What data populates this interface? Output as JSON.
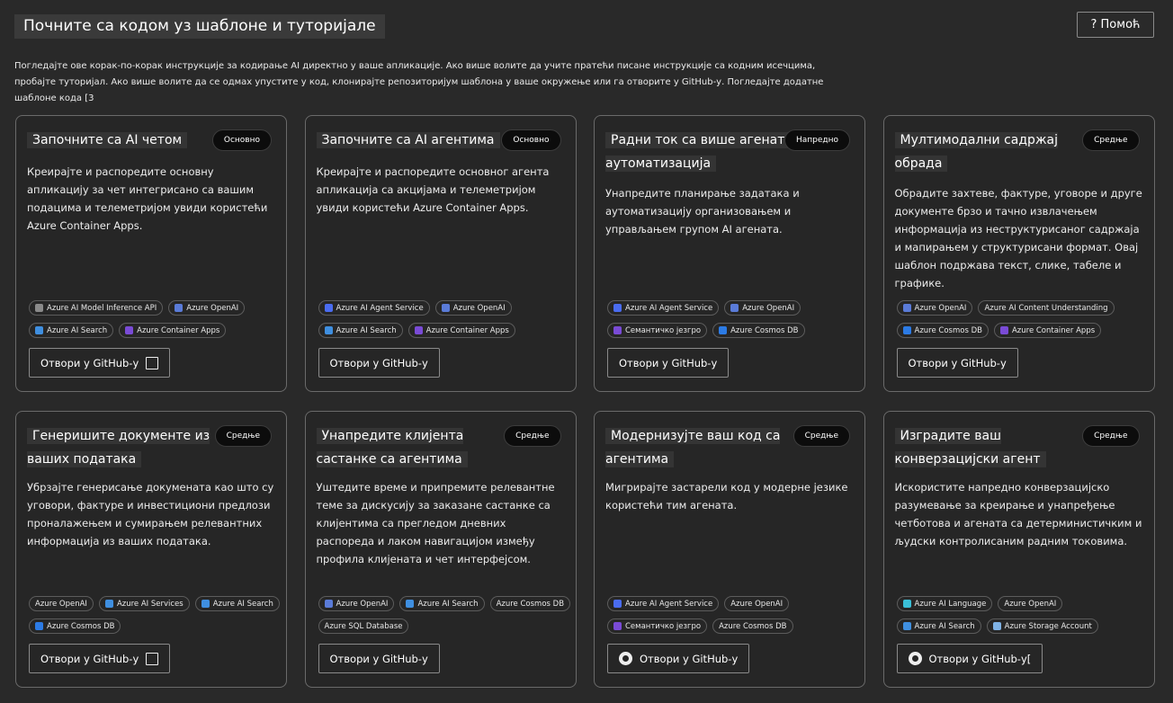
{
  "header": {
    "title": "Почните са кодом уз шаблоне и туторијале",
    "help_label": "? Помоћ",
    "intro": "Погледајте ове корак-по-корак инструкције за кодирање AI директно у ваше апликације. Ако више волите да учите пратећи писане инструкције са кодним исечцима, пробајте туторијал. Ако више волите да се одмах упустите у код, клонирајте репозиторијум шаблона у ваше окружење или га отворите у GitHub-у. Погледајте додатне шаблоне кода [3"
  },
  "colors": {
    "openai": "#5a7bd8",
    "search": "#3f8fe0",
    "agent": "#4a6cf0",
    "cosmos": "#2c7be5",
    "container": "#7a4bd6",
    "language": "#3ac0d8",
    "storage": "#7fb2e5",
    "sql": "#2a78d6",
    "function": "#c08a3e",
    "model": "#8a8a8a"
  },
  "cards": [
    {
      "title": "Започните са AI четом",
      "badge": "Основно",
      "description": "Креирајте и распоредите основну апликацију за чет интегрисано са вашим подацима и телеметријом увиди користећи Azure Container Apps.",
      "tags": [
        {
          "label": "Azure AI Model Inference API",
          "icon": "code-icon",
          "color": "model"
        },
        {
          "label": "Azure OpenAI",
          "icon": "openai-icon",
          "color": "openai"
        },
        {
          "label": "Azure AI Search",
          "icon": "search-cloud-icon",
          "color": "search"
        },
        {
          "label": "Azure Container Apps",
          "icon": "container-apps-icon",
          "color": "container"
        }
      ],
      "button": "Отвори у GitHub-у",
      "button_icon": "external-link-icon"
    },
    {
      "title": "Започните са AI агентима",
      "badge": "Основно",
      "description": "Креирајте и распоредите основног агента апликација са акцијама и телеметријом увиди користећи Azure Container Apps.",
      "tags": [
        {
          "label": "Azure AI Agent Service",
          "icon": "agent-icon",
          "color": "agent"
        },
        {
          "label": "Azure OpenAI",
          "icon": "openai-icon",
          "color": "openai"
        },
        {
          "label": "Azure AI Search",
          "icon": "search-cloud-icon",
          "color": "search"
        },
        {
          "label": "Azure Container Apps",
          "icon": "container-apps-icon",
          "color": "container"
        }
      ],
      "button": "Отвори у GitHub-у",
      "button_icon": ""
    },
    {
      "title": "Радни ток са више агената аутоматизација",
      "badge": "Напредно",
      "description": "Унапредите планирање задатака и аутоматизацију организовањем и управљањем групом AI агената.",
      "tags": [
        {
          "label": "Azure AI Agent Service",
          "icon": "agent-icon",
          "color": "agent"
        },
        {
          "label": "Azure OpenAI",
          "icon": "openai-icon",
          "color": "openai"
        },
        {
          "label": "Семантичко језгро",
          "icon": "semantic-kernel-icon",
          "color": "container"
        },
        {
          "label": "Azure Cosmos DB",
          "icon": "cosmos-db-icon",
          "color": "cosmos"
        }
      ],
      "button": "Отвори у GitHub-у",
      "button_icon": ""
    },
    {
      "title": "Мултимодални садржај обрада",
      "badge": "Средње",
      "description": "Обрадите захтеве, фактуре, уговоре и друге документе брзо и тачно извлачењем информација из неструктурисаног садржаја и мапирањем у структурисани формат. Овај шаблон подржава текст, слике, табеле и графике.",
      "tags": [
        {
          "label": "Azure OpenAI",
          "icon": "openai-icon",
          "color": "openai"
        },
        {
          "label": "Azure AI Content Understanding",
          "icon": "",
          "color": "model"
        },
        {
          "label": "Azure Cosmos DB",
          "icon": "cosmos-db-icon",
          "color": "cosmos"
        },
        {
          "label": "Azure Container Apps",
          "icon": "container-apps-icon",
          "color": "container"
        }
      ],
      "button": "Отвори у GitHub-у",
      "button_icon": ""
    },
    {
      "title": "Генеришите документе из ваших података",
      "badge": "Средње",
      "description": "Убрзајте генерисање докумената као што су уговори, фактуре и инвестициони предлози проналажењем и сумирањем релевантних информација из ваших података.",
      "tags": [
        {
          "label": "Azure OpenAI",
          "icon": "",
          "color": "openai"
        },
        {
          "label": "Azure AI Services",
          "icon": "ai-services-icon",
          "color": "search"
        },
        {
          "label": "Azure AI Search",
          "icon": "search-cloud-icon",
          "color": "search"
        },
        {
          "label": "Azure Cosmos DB",
          "icon": "cosmos-db-icon",
          "color": "cosmos"
        }
      ],
      "button": "Отвори у GitHub-у",
      "button_icon": "external-link-icon"
    },
    {
      "title": "Унапредите клијента састанке са агентима",
      "badge": "Средње",
      "description": "Уштедите време и припремите релевантне теме за дискусију за заказане састанке са клијентима са прегледом дневних распореда и лаком навигацијом између профила клијената и чет интерфејсом.",
      "tags": [
        {
          "label": "Azure OpenAI",
          "icon": "openai-icon",
          "color": "openai"
        },
        {
          "label": "Azure AI Search",
          "icon": "search-cloud-icon",
          "color": "search"
        },
        {
          "label": "Azure Cosmos DB",
          "icon": "",
          "color": "cosmos"
        },
        {
          "label": "Azure SQL Database",
          "icon": "",
          "color": "sql"
        }
      ],
      "button": "Отвори у GitHub-у",
      "button_icon": ""
    },
    {
      "title": "Модернизујте ваш код са агентима",
      "badge": "Средње",
      "description": "Мигрирајте застарели код у модерне језике користећи тим агената.",
      "tags": [
        {
          "label": "Azure AI Agent Service",
          "icon": "agent-icon",
          "color": "agent"
        },
        {
          "label": "Azure OpenAI",
          "icon": "",
          "color": "openai"
        },
        {
          "label": "Семантичко језгро",
          "icon": "semantic-kernel-icon",
          "color": "container"
        },
        {
          "label": "Azure Cosmos DB",
          "icon": "",
          "color": "cosmos"
        }
      ],
      "button": "Отвори у GitHub-у",
      "button_icon": "github-icon"
    },
    {
      "title": "Изградите ваш конверзацијски агент",
      "badge": "Средње",
      "description": "Искористите напредно конверзацијско разумевање за креирање и унапређење четботова и агената са детерминистичким и људски контролисаним радним токовима.",
      "tags": [
        {
          "label": "Azure AI Language",
          "icon": "language-icon",
          "color": "language"
        },
        {
          "label": "Azure OpenAI",
          "icon": "",
          "color": "openai"
        },
        {
          "label": "Azure AI Search",
          "icon": "search-cloud-icon",
          "color": "search"
        },
        {
          "label": "Azure Storage Account",
          "icon": "storage-icon",
          "color": "storage"
        }
      ],
      "button": "Отвори у GitHub-у[",
      "button_icon": "github-icon"
    }
  ]
}
